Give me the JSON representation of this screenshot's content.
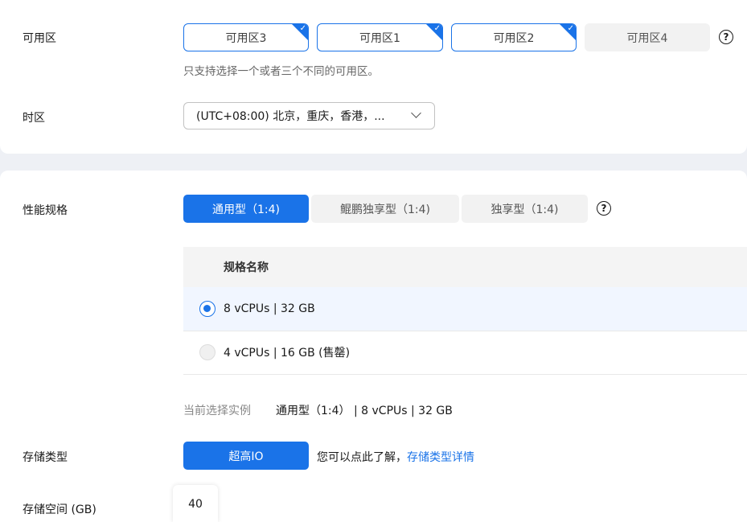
{
  "az": {
    "label": "可用区",
    "options": [
      {
        "label": "可用区3",
        "selected": true
      },
      {
        "label": "可用区1",
        "selected": true
      },
      {
        "label": "可用区2",
        "selected": true
      },
      {
        "label": "可用区4",
        "selected": false
      }
    ],
    "hint": "只支持选择一个或者三个不同的可用区。"
  },
  "tz": {
    "label": "时区",
    "value": "(UTC+08:00) 北京，重庆，香港，..."
  },
  "perf": {
    "label": "性能规格",
    "tabs": [
      {
        "label": "通用型（1:4)",
        "active": true
      },
      {
        "label": "鲲鹏独享型（1:4)",
        "active": false
      },
      {
        "label": "独享型（1:4)",
        "active": false
      }
    ],
    "table_header": "规格名称",
    "rows": [
      {
        "label": "8 vCPUs | 32 GB",
        "selected": true
      },
      {
        "label": "4 vCPUs | 16 GB (售罄)",
        "selected": false
      }
    ],
    "current_label": "当前选择实例",
    "current_value": "通用型（1:4） | 8 vCPUs | 32 GB"
  },
  "storage": {
    "type_label": "存储类型",
    "type_button": "超高IO",
    "info_text": "您可以点此了解，",
    "info_link": "存储类型详情",
    "space_label": "存储空间 (GB)",
    "space_value": "40"
  },
  "icons": {
    "help": "?",
    "check": "✓"
  },
  "colors": {
    "accent": "#1a73e8"
  }
}
